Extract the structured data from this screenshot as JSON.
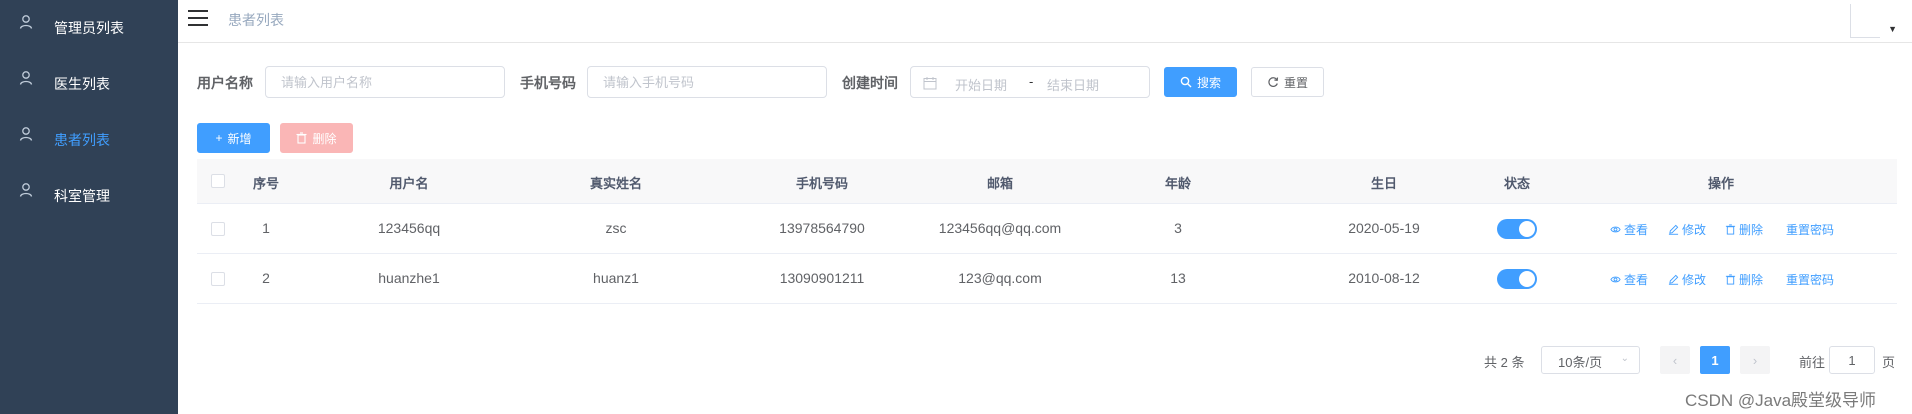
{
  "sidebar": {
    "items": [
      {
        "label": "管理员列表",
        "icon": "user-icon",
        "active": false
      },
      {
        "label": "医生列表",
        "icon": "user-icon",
        "active": false
      },
      {
        "label": "患者列表",
        "icon": "user-icon",
        "active": true
      },
      {
        "label": "科室管理",
        "icon": "user-icon",
        "active": false
      }
    ],
    "bg_color": "#304156",
    "active_color": "#409eff"
  },
  "header": {
    "breadcrumb": "患者列表"
  },
  "search": {
    "username_label": "用户名称",
    "username_placeholder": "请输入用户名称",
    "phone_label": "手机号码",
    "phone_placeholder": "请输入手机号码",
    "created_label": "创建时间",
    "start_placeholder": "开始日期",
    "range_separator": "-",
    "end_placeholder": "结束日期",
    "search_button": "搜索",
    "reset_button": "重置"
  },
  "toolbar": {
    "add_button": "新增",
    "delete_button": "删除"
  },
  "table": {
    "columns": [
      "序号",
      "用户名",
      "真实姓名",
      "手机号码",
      "邮箱",
      "年龄",
      "生日",
      "状态",
      "操作"
    ],
    "rows": [
      {
        "index": "1",
        "username": "123456qq",
        "real_name": "zsc",
        "phone": "13978564790",
        "email": "123456qq@qq.com",
        "age": "3",
        "birthday": "2020-05-19",
        "status_on": true
      },
      {
        "index": "2",
        "username": "huanzhe1",
        "real_name": "huanz1",
        "phone": "13090901211",
        "email": "123@qq.com",
        "age": "13",
        "birthday": "2010-08-12",
        "status_on": true
      }
    ],
    "actions": {
      "view": "查看",
      "edit": "修改",
      "delete": "删除",
      "reset_password": "重置密码"
    }
  },
  "pagination": {
    "total_text": "共 2 条",
    "page_size": "10条/页",
    "current_page": "1",
    "goto_label": "前往",
    "goto_value": "1",
    "goto_unit": "页"
  },
  "watermark": "CSDN @Java殿堂级导师",
  "colors": {
    "primary": "#409eff",
    "danger_disabled": "#fab6b6"
  }
}
